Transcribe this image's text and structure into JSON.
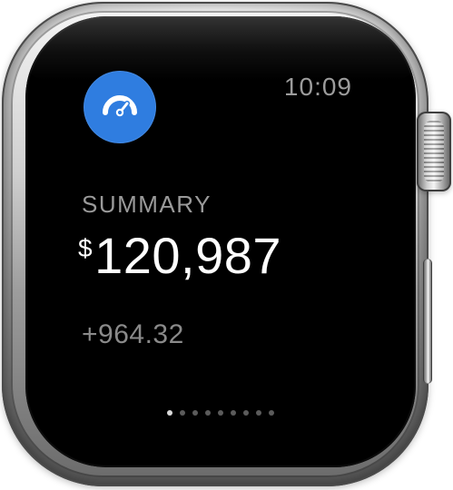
{
  "screen": {
    "time": "10:09",
    "app_icon": "gauge-icon",
    "summary": {
      "label": "SUMMARY",
      "currency_symbol": "$",
      "amount": "120,987",
      "change": "+964.32"
    },
    "pager": {
      "count": 9,
      "active_index": 0
    }
  },
  "colors": {
    "screen_bg": "#000000",
    "app_icon_bg": "#2f7de0",
    "primary_text": "#ffffff",
    "secondary_text": "#9a9a9a"
  }
}
